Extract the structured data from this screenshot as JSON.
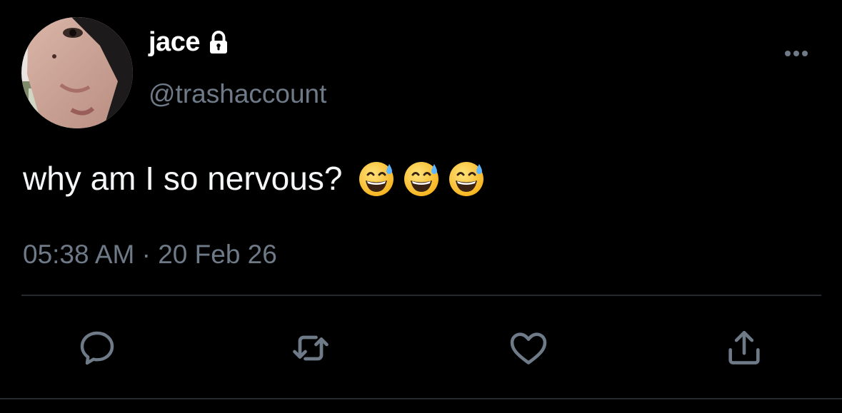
{
  "tweet": {
    "display_name": "jace",
    "handle": "@trashaccount",
    "text": "why am I so nervous?",
    "emojis": [
      "grinning-face-with-sweat",
      "grinning-face-with-sweat",
      "grinning-face-with-sweat"
    ],
    "timestamp": "05:38 AM · 20 Feb 26",
    "protected": true
  },
  "actions": [
    {
      "name": "reply",
      "icon": "speech-bubble-icon"
    },
    {
      "name": "retweet",
      "icon": "retweet-arrows-icon"
    },
    {
      "name": "like",
      "icon": "heart-icon"
    },
    {
      "name": "share",
      "icon": "share-upload-icon"
    }
  ],
  "colors": {
    "background": "#000000",
    "primary_text": "#ffffff",
    "secondary_text": "#6e7a87",
    "divider": "#25292e",
    "icon": "#6e7a87"
  }
}
